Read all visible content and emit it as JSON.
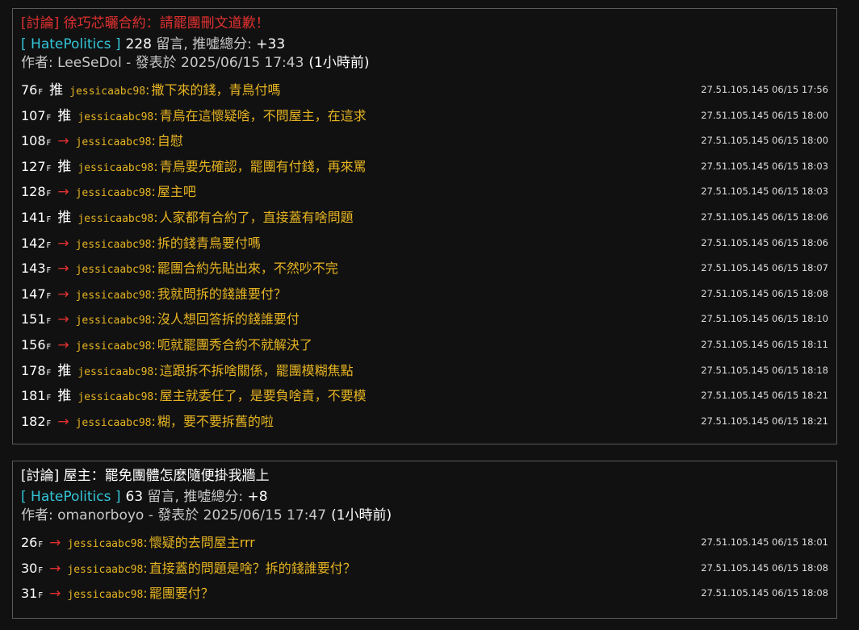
{
  "posts": [
    {
      "title": "[討論] 徐巧芯曬合約：請罷團刪文道歉！",
      "title_color": "#e03030",
      "board": "[ HatePolitics ]",
      "comment_count": "228",
      "score_label": " 留言, 推噓總分: ",
      "score": "+33",
      "author_line": "作者: LeeSeDol - 發表於 2025/06/15 17:43",
      "ago": "(1小時前)",
      "comments": [
        {
          "floor": "76",
          "tag": "推",
          "type": "push",
          "user": "jessicaabc98",
          "text": "撒下來的錢，青鳥付嗎",
          "ipdate": "27.51.105.145 06/15 17:56"
        },
        {
          "floor": "107",
          "tag": "推",
          "type": "push",
          "user": "jessicaabc98",
          "text": "青鳥在這懷疑啥，不問屋主，在這求",
          "ipdate": "27.51.105.145 06/15 18:00"
        },
        {
          "floor": "108",
          "tag": "→",
          "type": "arrow",
          "user": "jessicaabc98",
          "text": "自慰",
          "ipdate": "27.51.105.145 06/15 18:00"
        },
        {
          "floor": "127",
          "tag": "推",
          "type": "push",
          "user": "jessicaabc98",
          "text": "青鳥要先確認，罷團有付錢，再來罵",
          "ipdate": "27.51.105.145 06/15 18:03"
        },
        {
          "floor": "128",
          "tag": "→",
          "type": "arrow",
          "user": "jessicaabc98",
          "text": "屋主吧",
          "ipdate": "27.51.105.145 06/15 18:03"
        },
        {
          "floor": "141",
          "tag": "推",
          "type": "push",
          "user": "jessicaabc98",
          "text": "人家都有合約了，直接蓋有啥問題",
          "ipdate": "27.51.105.145 06/15 18:06"
        },
        {
          "floor": "142",
          "tag": "→",
          "type": "arrow",
          "user": "jessicaabc98",
          "text": "拆的錢青鳥要付嗎",
          "ipdate": "27.51.105.145 06/15 18:06"
        },
        {
          "floor": "143",
          "tag": "→",
          "type": "arrow",
          "user": "jessicaabc98",
          "text": "罷團合約先貼出來，不然吵不完",
          "ipdate": "27.51.105.145 06/15 18:07"
        },
        {
          "floor": "147",
          "tag": "→",
          "type": "arrow",
          "user": "jessicaabc98",
          "text": "我就問拆的錢誰要付？",
          "ipdate": "27.51.105.145 06/15 18:08"
        },
        {
          "floor": "151",
          "tag": "→",
          "type": "arrow",
          "user": "jessicaabc98",
          "text": "沒人想回答拆的錢誰要付",
          "ipdate": "27.51.105.145 06/15 18:10"
        },
        {
          "floor": "156",
          "tag": "→",
          "type": "arrow",
          "user": "jessicaabc98",
          "text": "呃就罷團秀合約不就解決了",
          "ipdate": "27.51.105.145 06/15 18:11"
        },
        {
          "floor": "178",
          "tag": "推",
          "type": "push",
          "user": "jessicaabc98",
          "text": "這跟拆不拆啥關係，罷團模糊焦點",
          "ipdate": "27.51.105.145 06/15 18:18"
        },
        {
          "floor": "181",
          "tag": "推",
          "type": "push",
          "user": "jessicaabc98",
          "text": "屋主就委任了，是要負啥責，不要模",
          "ipdate": "27.51.105.145 06/15 18:21"
        },
        {
          "floor": "182",
          "tag": "→",
          "type": "arrow",
          "user": "jessicaabc98",
          "text": "糊，要不要拆舊的啦",
          "ipdate": "27.51.105.145 06/15 18:21"
        }
      ]
    },
    {
      "title": "[討論] 屋主：罷免團體怎麼隨便掛我牆上",
      "title_color": "#ffffff",
      "board": "[ HatePolitics ]",
      "comment_count": "63",
      "score_label": " 留言, 推噓總分: ",
      "score": "+8",
      "author_line": "作者: omanorboyo - 發表於 2025/06/15 17:47",
      "ago": "(1小時前)",
      "comments": [
        {
          "floor": "26",
          "tag": "→",
          "type": "arrow",
          "user": "jessicaabc98",
          "text": "懷疑的去問屋主rrr",
          "ipdate": "27.51.105.145 06/15 18:01"
        },
        {
          "floor": "30",
          "tag": "→",
          "type": "arrow",
          "user": "jessicaabc98",
          "text": "直接蓋的問題是啥？拆的錢誰要付？",
          "ipdate": "27.51.105.145 06/15 18:08"
        },
        {
          "floor": "31",
          "tag": "→",
          "type": "arrow",
          "user": "jessicaabc98",
          "text": "罷團要付？",
          "ipdate": "27.51.105.145 06/15 18:08"
        }
      ]
    }
  ],
  "floor_suffix": "F",
  "colors": {
    "board": "#33c5d8",
    "comment_text": "#e6b422",
    "arrow": "#e03030",
    "background": "#111111",
    "border": "#5a5a5a"
  }
}
